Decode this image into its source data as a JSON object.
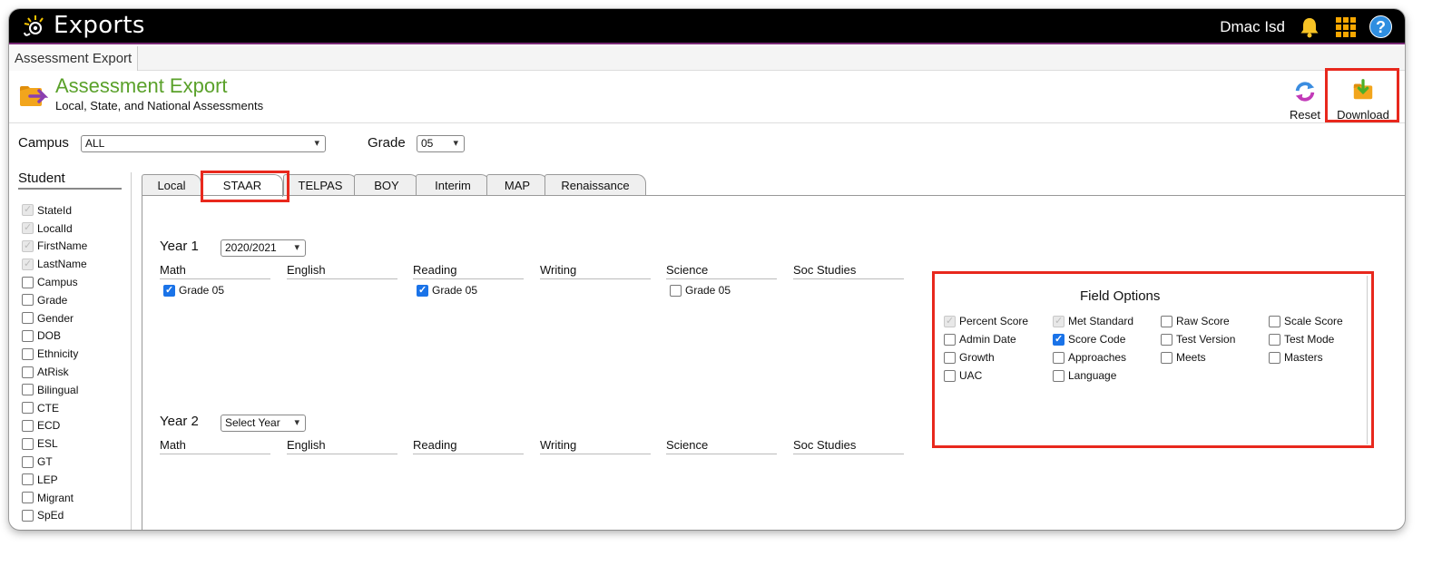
{
  "topbar": {
    "app_title": "Exports",
    "user_name": "Dmac Isd"
  },
  "breadcrumb": {
    "tab": "Assessment Export"
  },
  "header": {
    "title": "Assessment Export",
    "subtitle": "Local, State, and National Assessments",
    "reset_label": "Reset",
    "download_label": "Download"
  },
  "filters": {
    "campus_label": "Campus",
    "campus_value": "ALL",
    "grade_label": "Grade",
    "grade_value": "05"
  },
  "student": {
    "heading": "Student",
    "fields": [
      {
        "label": "StateId",
        "checked": true,
        "disabled": true
      },
      {
        "label": "LocalId",
        "checked": true,
        "disabled": true
      },
      {
        "label": "FirstName",
        "checked": true,
        "disabled": true
      },
      {
        "label": "LastName",
        "checked": true,
        "disabled": true
      },
      {
        "label": "Campus",
        "checked": false,
        "disabled": false
      },
      {
        "label": "Grade",
        "checked": false,
        "disabled": false
      },
      {
        "label": "Gender",
        "checked": false,
        "disabled": false
      },
      {
        "label": "DOB",
        "checked": false,
        "disabled": false
      },
      {
        "label": "Ethnicity",
        "checked": false,
        "disabled": false
      },
      {
        "label": "AtRisk",
        "checked": false,
        "disabled": false
      },
      {
        "label": "Bilingual",
        "checked": false,
        "disabled": false
      },
      {
        "label": "CTE",
        "checked": false,
        "disabled": false
      },
      {
        "label": "ECD",
        "checked": false,
        "disabled": false
      },
      {
        "label": "ESL",
        "checked": false,
        "disabled": false
      },
      {
        "label": "GT",
        "checked": false,
        "disabled": false
      },
      {
        "label": "LEP",
        "checked": false,
        "disabled": false
      },
      {
        "label": "Migrant",
        "checked": false,
        "disabled": false
      },
      {
        "label": "SpEd",
        "checked": false,
        "disabled": false
      }
    ]
  },
  "tabs": [
    {
      "label": "Local",
      "active": false
    },
    {
      "label": "STAAR",
      "active": true
    },
    {
      "label": "TELPAS",
      "active": false
    },
    {
      "label": "BOY",
      "active": false
    },
    {
      "label": "Interim",
      "active": false
    },
    {
      "label": "MAP",
      "active": false
    },
    {
      "label": "Renaissance",
      "active": false
    }
  ],
  "subjects": [
    "Math",
    "English",
    "Reading",
    "Writing",
    "Science",
    "Soc Studies"
  ],
  "year1": {
    "label": "Year 1",
    "value": "2020/2021",
    "grades": [
      {
        "subject": "Math",
        "label": "Grade 05",
        "checked": true
      },
      {
        "subject": "Reading",
        "label": "Grade 05",
        "checked": true
      },
      {
        "subject": "Science",
        "label": "Grade 05",
        "checked": false
      }
    ]
  },
  "year2": {
    "label": "Year 2",
    "value": "Select Year"
  },
  "field_options": {
    "title": "Field Options",
    "items": [
      {
        "label": "Percent Score",
        "checked": true,
        "disabled": true
      },
      {
        "label": "Met Standard",
        "checked": true,
        "disabled": true
      },
      {
        "label": "Raw Score",
        "checked": false,
        "disabled": false
      },
      {
        "label": "Scale Score",
        "checked": false,
        "disabled": false
      },
      {
        "label": "Admin Date",
        "checked": false,
        "disabled": false
      },
      {
        "label": "Score Code",
        "checked": true,
        "disabled": false
      },
      {
        "label": "Test Version",
        "checked": false,
        "disabled": false
      },
      {
        "label": "Test Mode",
        "checked": false,
        "disabled": false
      },
      {
        "label": "Growth",
        "checked": false,
        "disabled": false
      },
      {
        "label": "Approaches",
        "checked": false,
        "disabled": false
      },
      {
        "label": "Meets",
        "checked": false,
        "disabled": false
      },
      {
        "label": "Masters",
        "checked": false,
        "disabled": false
      },
      {
        "label": "UAC",
        "checked": false,
        "disabled": false
      },
      {
        "label": "Language",
        "checked": false,
        "disabled": false
      }
    ]
  },
  "colors": {
    "accent_green": "#5aa12a",
    "highlight_red": "#e8281d",
    "checkbox_blue": "#1a73e8"
  }
}
